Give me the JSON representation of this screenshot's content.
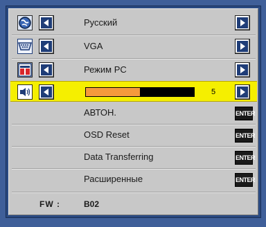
{
  "menu": {
    "rows": [
      {
        "label": "Русский",
        "icon": "globe-icon"
      },
      {
        "label": "VGA",
        "icon": "vga-connector-icon"
      },
      {
        "label": "Режим PC",
        "icon": "display-mode-icon"
      },
      {
        "label": "",
        "icon": "volume-icon",
        "slider_value": "5",
        "slider_fraction": 0.5,
        "selected": true
      }
    ],
    "actions": [
      {
        "label": "АВТОН.",
        "button": "ENTER"
      },
      {
        "label": "OSD Reset",
        "button": "ENTER"
      },
      {
        "label": "Data Transferring",
        "button": "ENTER"
      },
      {
        "label": "Расширенные",
        "button": "ENTER"
      }
    ]
  },
  "footer": {
    "fw_label": "FW :",
    "fw_value": "B02"
  },
  "colors": {
    "background": "#3f5f99",
    "panel": "#c8c8c8",
    "selection": "#f5ef00",
    "slider_fill": "#f59a3c",
    "arrow_button": "#1f3d78"
  }
}
